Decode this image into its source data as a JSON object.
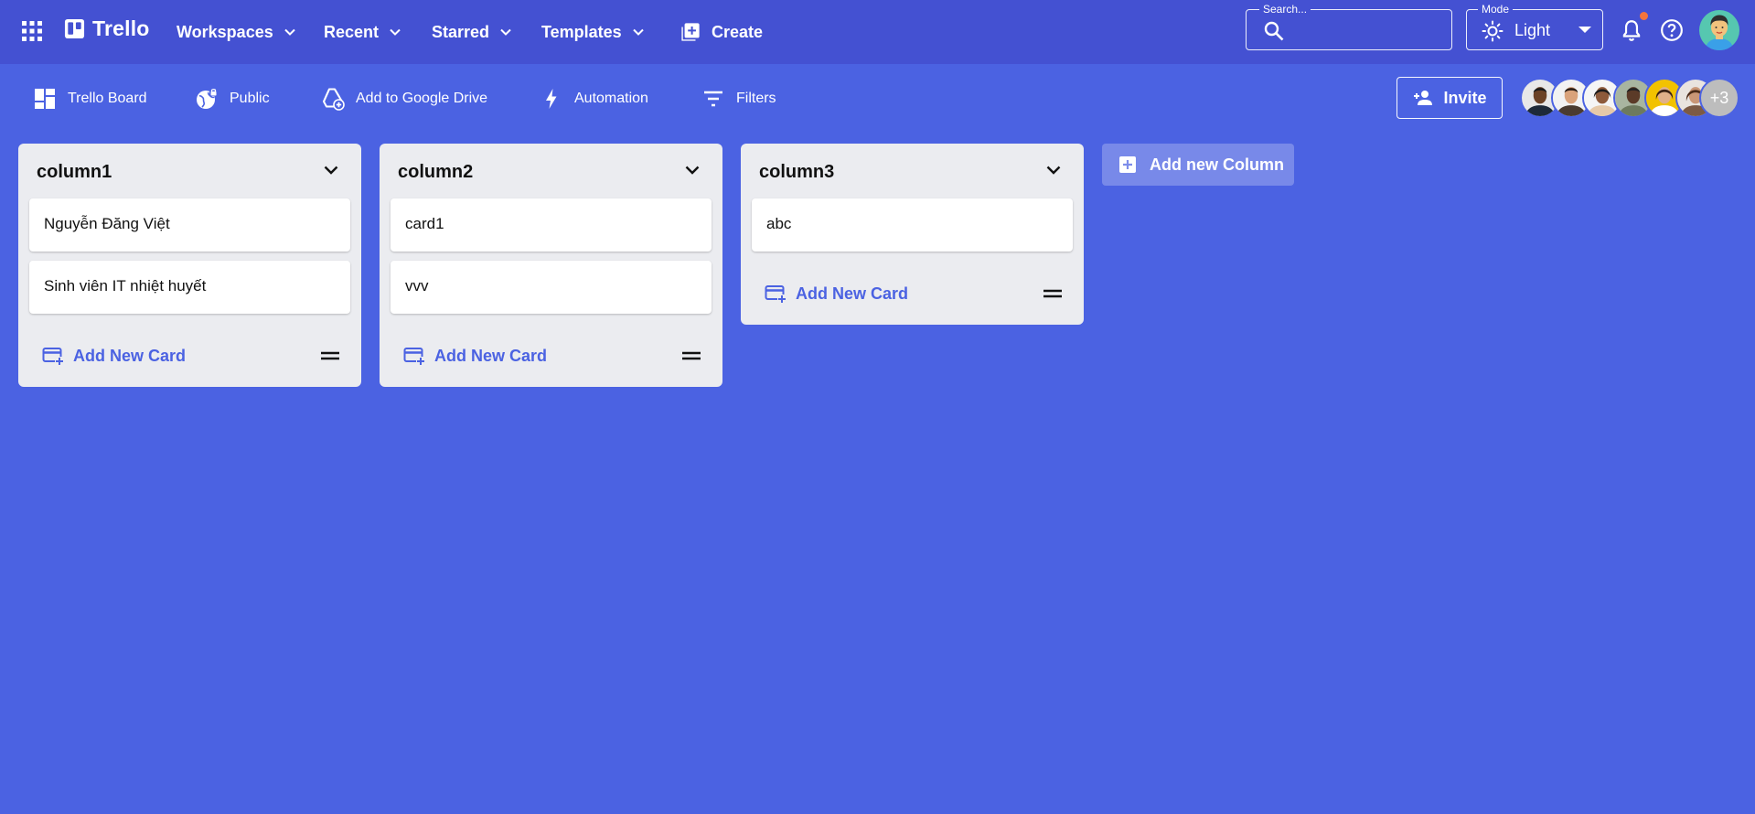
{
  "appbar": {
    "brand": "Trello",
    "nav": [
      {
        "label": "Workspaces"
      },
      {
        "label": "Recent"
      },
      {
        "label": "Starred"
      },
      {
        "label": "Templates"
      }
    ],
    "create_label": "Create",
    "search": {
      "label": "Search...",
      "value": ""
    },
    "mode": {
      "label": "Mode",
      "value": "Light"
    },
    "notification_dot_color": "#f4743b"
  },
  "boardbar": {
    "items": [
      {
        "label": "Trello Board",
        "icon": "dashboard-icon"
      },
      {
        "label": "Public",
        "icon": "public-globe-icon"
      },
      {
        "label": "Add to Google Drive",
        "icon": "add-to-drive-icon"
      },
      {
        "label": "Automation",
        "icon": "bolt-icon"
      },
      {
        "label": "Filters",
        "icon": "filter-icon"
      }
    ],
    "invite_label": "Invite",
    "members_more": "+3"
  },
  "columns": [
    {
      "title": "column1",
      "cards": [
        "Nguyễn Đăng Việt",
        "Sinh viên IT nhiệt huyết"
      ],
      "add_label": "Add New Card"
    },
    {
      "title": "column2",
      "cards": [
        "card1",
        "vvv"
      ],
      "add_label": "Add New Card"
    },
    {
      "title": "column3",
      "cards": [
        "abc"
      ],
      "add_label": "Add New Card"
    }
  ],
  "add_column_label": "Add new Column",
  "colors": {
    "appbar_bg": "#4451d2",
    "board_bg": "#4b62e2",
    "column_bg": "#ebecf0",
    "accent": "#4b62e2"
  }
}
